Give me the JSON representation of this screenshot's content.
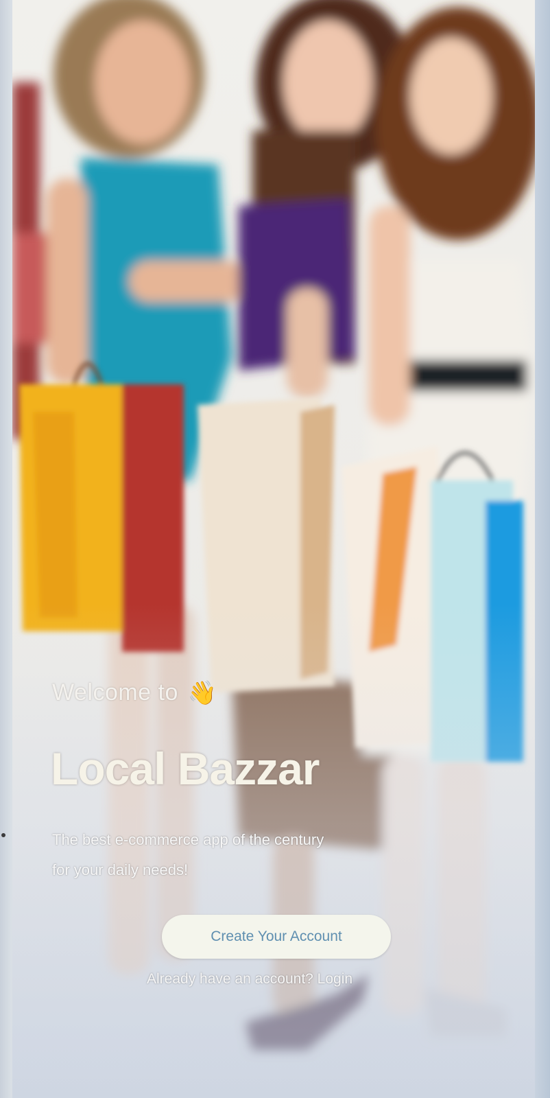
{
  "welcome": {
    "text": "Welcome to",
    "icon": "waving-hand-icon",
    "icon_glyph": "👋"
  },
  "app": {
    "title": "Local Bazzar"
  },
  "tagline": {
    "line1": "The best e-commerce app of the century",
    "line2": "for your daily needs!"
  },
  "actions": {
    "create_account_label": "Create Your Account",
    "login_prompt": "Already have an account?",
    "login_label": "Login"
  },
  "colors": {
    "title": "#f6f3e8",
    "button_bg": "#f4f5ec",
    "button_text": "#5f8fb0",
    "wave": "#f2b21c"
  }
}
